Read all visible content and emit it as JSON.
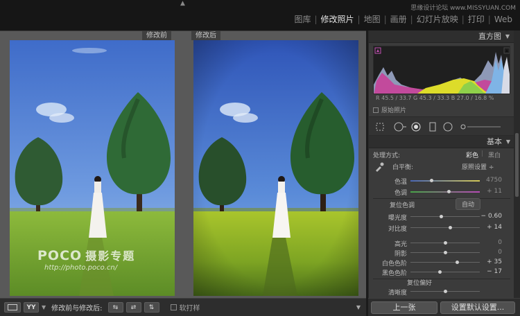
{
  "top": {
    "watermark": "思缘设计论坛 www.MISSYUAN.COM",
    "modules": [
      "图库",
      "修改照片",
      "地图",
      "画册",
      "幻灯片放映",
      "打印",
      "Web"
    ],
    "active_module": "修改照片"
  },
  "compare": {
    "before_label": "修改前",
    "after_label": "修改后",
    "watermark_brand": "POCO",
    "watermark_cn": "摄影专题",
    "watermark_url": "http://photo.poco.cn/"
  },
  "toolbar": {
    "view_mode": "YY",
    "compare_label": "修改前与修改后:",
    "soft_proof": "软打样"
  },
  "histogram": {
    "title": "直方图",
    "readout": "R  45.5 / 33.7  G  45.3 / 33.3  B  27.0 / 16.8  %",
    "original_photo": "原始照片"
  },
  "basic": {
    "title": "基本",
    "treatment_label": "处理方式:",
    "treatment_color": "彩色",
    "treatment_bw": "黑白",
    "wb_label": "白平衡:",
    "wb_value": "原照设置 ÷",
    "temp_label": "色温",
    "temp_value": "4750",
    "temp_pos": 0.3,
    "tint_label": "色调",
    "tint_value": "+ 11",
    "tint_pos": 0.55,
    "tone_label": "复位色调",
    "auto_label": "自动",
    "exposure_label": "曝光度",
    "exposure_value": "− 0.60",
    "exposure_pos": 0.44,
    "contrast_label": "对比度",
    "contrast_value": "+ 14",
    "contrast_pos": 0.57,
    "highlights_label": "高光",
    "highlights_value": "0",
    "highlights_pos": 0.5,
    "shadows_label": "阴影",
    "shadows_value": "0",
    "shadows_pos": 0.5,
    "whites_label": "白色色阶",
    "whites_value": "+ 35",
    "whites_pos": 0.67,
    "blacks_label": "黑色色阶",
    "blacks_value": "− 17",
    "blacks_pos": 0.42,
    "presence_label": "复位偏好",
    "clarity_label": "清晰度",
    "clarity_pos": 0.5
  },
  "footer": {
    "prev": "上一张",
    "set_default": "设置默认设置..."
  }
}
